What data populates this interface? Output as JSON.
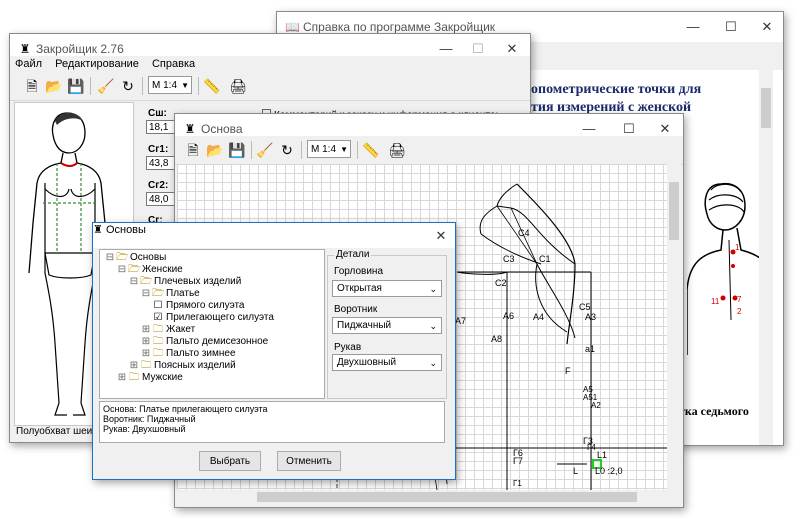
{
  "help": {
    "title": "Справка по программе Закройщик",
    "text_line1": "опометрические точки для",
    "text_line2": "тия измерений с женской",
    "caption": "тка седьмого",
    "markers": [
      "1",
      "2",
      "11",
      "7"
    ]
  },
  "main": {
    "title": "Закройщик 2.76",
    "menu": [
      "Файл",
      "Редактирование",
      "Справка"
    ],
    "scale": "М 1:4",
    "comment_label": "Комментарий к заказу и информация о клиенте:",
    "status": "Полуобхват шеи",
    "measurements": [
      {
        "label": "Сш:",
        "value": "18,1"
      },
      {
        "label": "Сг1:",
        "value": "43,8"
      },
      {
        "label": "Сг2:",
        "value": "48,0"
      },
      {
        "label": "Сг:",
        "value": ""
      }
    ]
  },
  "osnova": {
    "title": "Основа",
    "scale": "М 1:4",
    "points": [
      "C4",
      "C3",
      "C1",
      "C2",
      "C5",
      "A7",
      "A6",
      "A4",
      "A3",
      "A8",
      "a1",
      "F",
      "A5",
      "A51",
      "A2",
      "Г4",
      "Г1",
      "Г6",
      "Г7",
      "Г3",
      "L1",
      "L",
      "L0 :2,0"
    ]
  },
  "dialog": {
    "title": "Основы",
    "tree": [
      {
        "label": "Основы",
        "level": 0,
        "icon": "folder-open-icon",
        "expander": "⊟"
      },
      {
        "label": "Женские",
        "level": 1,
        "icon": "folder-open-icon",
        "expander": "⊟"
      },
      {
        "label": "Плечевых изделий",
        "level": 2,
        "icon": "folder-open-icon",
        "expander": "⊟"
      },
      {
        "label": "Платье",
        "level": 3,
        "icon": "folder-open-icon",
        "expander": "⊟"
      },
      {
        "label": "Прямого силуэта",
        "level": 4,
        "icon": "checkbox-icon",
        "checked": false
      },
      {
        "label": "Прилегающего силуэта",
        "level": 4,
        "icon": "checkbox-icon",
        "checked": true
      },
      {
        "label": "Жакет",
        "level": 3,
        "icon": "folder-icon",
        "expander": "⊞"
      },
      {
        "label": "Пальто демисезонное",
        "level": 3,
        "icon": "folder-icon",
        "expander": "⊞"
      },
      {
        "label": "Пальто зимнее",
        "level": 3,
        "icon": "folder-icon",
        "expander": "⊞"
      },
      {
        "label": "Поясных изделий",
        "level": 2,
        "icon": "folder-icon",
        "expander": "⊞"
      },
      {
        "label": "Мужские",
        "level": 1,
        "icon": "folder-icon",
        "expander": "⊞"
      }
    ],
    "details_title": "Детали",
    "neckline_label": "Горловина",
    "neckline_value": "Открытая",
    "collar_label": "Воротник",
    "collar_value": "Пиджачный",
    "sleeve_label": "Рукав",
    "sleeve_value": "Двухшовный",
    "info_lines": [
      "Основа: Платье прилегающего силуэта",
      "Воротник: Пиджачный",
      "Рукав: Двухшовный"
    ],
    "select_button": "Выбрать",
    "cancel_button": "Отменить"
  }
}
